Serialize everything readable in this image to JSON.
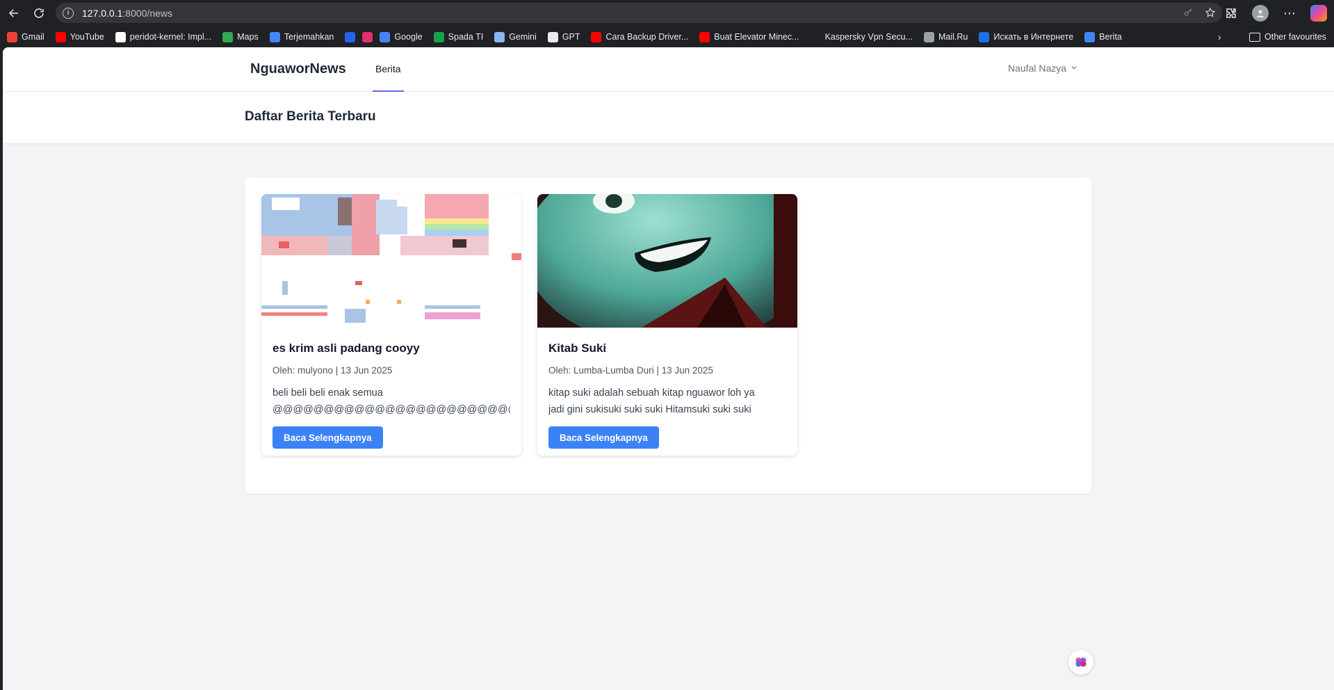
{
  "browser": {
    "url_host": "127.0.0.1",
    "url_rest": ":8000/news",
    "bookmarks": [
      {
        "label": "Gmail",
        "icon": "gmail-icon",
        "color": "#ea4335"
      },
      {
        "label": "YouTube",
        "icon": "youtube-icon",
        "color": "#ff0000"
      },
      {
        "label": "peridot-kernel: Impl...",
        "icon": "github-icon",
        "color": "#ffffff"
      },
      {
        "label": "Maps",
        "icon": "maps-icon",
        "color": "#34a853"
      },
      {
        "label": "Terjemahkan",
        "icon": "translate-icon",
        "color": "#4285f4"
      },
      {
        "label": "",
        "icon": "app-icon",
        "color": "#2563eb"
      },
      {
        "label": "",
        "icon": "instagram-icon",
        "color": "#e1306c"
      },
      {
        "label": "Google",
        "icon": "google-icon",
        "color": "#4285f4"
      },
      {
        "label": "Spada TI",
        "icon": "spada-icon",
        "color": "#16a34a"
      },
      {
        "label": "Gemini",
        "icon": "gemini-icon",
        "color": "#8ab4f8"
      },
      {
        "label": "GPT",
        "icon": "openai-icon",
        "color": "#e8eaed"
      },
      {
        "label": "Cara Backup Driver...",
        "icon": "youtube-icon",
        "color": "#ff0000"
      },
      {
        "label": "Buat Elevator Minec...",
        "icon": "youtube-icon",
        "color": "#ff0000"
      },
      {
        "label": "Kaspersky Vpn Secu...",
        "icon": "blank-icon",
        "color": "#202124"
      },
      {
        "label": "Mail.Ru",
        "icon": "globe-icon",
        "color": "#9aa0a6"
      },
      {
        "label": "Искать в Интернете",
        "icon": "search-icon",
        "color": "#1a73e8"
      },
      {
        "label": "Berita",
        "icon": "news-icon",
        "color": "#4285f4"
      }
    ],
    "other_favourites": "Other favourites"
  },
  "nav": {
    "brand": "NguaworNews",
    "link": "Berita",
    "user": "Naufal Nazya"
  },
  "header": {
    "title": "Daftar Berita Terbaru"
  },
  "news": [
    {
      "title": "es krim asli padang cooyy",
      "meta": "Oleh: mulyono | 13 Jun 2025",
      "excerpt_line1": "beli beli beli enak semua",
      "excerpt_line2": "@@@@@@@@@@@@@@@@@@@@@@@@@@@@@@@@@@@",
      "button": "Baca Selengkapnya"
    },
    {
      "title": "Kitab Suki",
      "meta": "Oleh: Lumba-Lumba Duri | 13 Jun 2025",
      "excerpt_line1": "kitap suki adalah sebuah kitap nguawor loh ya",
      "excerpt_line2": "jadi gini sukisuki suki suki Hitamsuki suki suki",
      "button": "Baca Selengkapnya"
    }
  ],
  "colors": {
    "accent": "#3b82f6",
    "nav_active": "#6366f1"
  }
}
